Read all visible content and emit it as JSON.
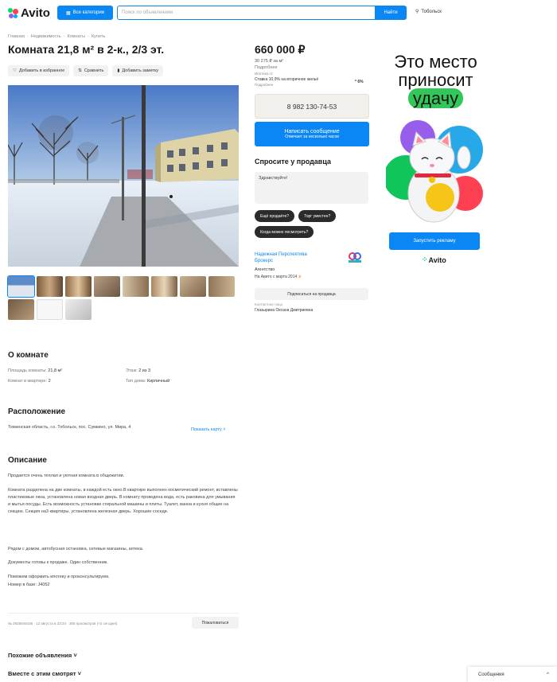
{
  "header": {
    "logo_text": "Avito",
    "categories_label": "Все категории",
    "search_placeholder": "Поиск по объявлениям",
    "search_button": "Найти",
    "location": "Тобольск"
  },
  "breadcrumb": [
    "Главная",
    "Недвижимость",
    "Комнаты",
    "Купить"
  ],
  "listing": {
    "title": "Комната 21,8 м² в 2-к., 2/3 эт.",
    "actions": [
      "Добавить в избранное",
      "Сравнить",
      "Добавить заметку"
    ],
    "thumb_count": 11
  },
  "sidebar": {
    "price": "660 000 ₽",
    "price_per_m2": "30 275 ₽ за м²",
    "price_link": "Подробнее",
    "mortgage_label": "Ипотека от",
    "mortgage_text": "Ставка 10,9% на вторичное жильё",
    "mortgage_link": "Подробнее",
    "mortgage_pct": "* 6%",
    "phone": "8 982 130-74-53",
    "message_label": "Написать сообщение",
    "message_sub": "Отвечает за несколько часов",
    "ask_title": "Спросите у продавца",
    "ask_placeholder": "Здравствуйте!",
    "chips": [
      "Ещё продаёте?",
      "Торг уместен?",
      "Когда можно посмотреть?"
    ],
    "seller_name_1": "Надежная Перспектива",
    "seller_name_2": "Брокерс",
    "seller_type": "Агентство",
    "seller_since": "На Авито с марта 2014",
    "subscribe_label": "Подписаться на продавца",
    "contact_label": "Контактное лицо",
    "contact_name": "Глазырина Оксана Дмитриевна"
  },
  "ad": {
    "line1": "Это место",
    "line2": "приносит",
    "highlight": "удачу",
    "button": "Запустить рекламу",
    "logo_text": "Avito"
  },
  "about": {
    "title": "О комнате",
    "rows": [
      {
        "label": "Площадь комнаты:",
        "value": "21,8 м²"
      },
      {
        "label": "Этаж:",
        "value": "2 из 3"
      },
      {
        "label": "Комнат в квартире:",
        "value": "2"
      },
      {
        "label": "Тип дома:",
        "value": "Кирпичный"
      }
    ]
  },
  "location": {
    "title": "Расположение",
    "address": "Тюменская область, г.о. Тобольск, пос. Сумкино, ул. Мира, 4",
    "map_link": "Показать карту ˅"
  },
  "description": {
    "title": "Описание",
    "p1": "Продается очень теплая и уютная комната в общежитии.",
    "p2": "Комната разделена на две комнаты, в каждой есть окно.В квартире выполнен косметический ремонт, вставлены пластиковые окна, установлена новая входная дверь. В комнату проведена вода, есть раковина для умывания и мытья посуды. Есть возможность установки стиральной машины и плиты. Туалет, ванна и кухня общие на секцию. Секция на3 квартиры, установлена железная дверь. Хорошие соседи.",
    "p3": "Рядом с домом, автобусная остановка, сетевые магазины, аптека.",
    "p4": "Документы готовы к продаже. Один собственник.",
    "p5": "Поможем оформить ипотеку и проконсультируем.",
    "p6": "Номер в базе: J4052"
  },
  "footer": {
    "meta": "№ 2925945436 · 12 августа в 23:24 · 305 просмотров (+2 сегодня)",
    "complain": "Пожаловаться",
    "similar": "Похожие объявления ˅",
    "also_viewed": "Вместе с этим смотрят ˅",
    "messages": "Сообщения"
  }
}
